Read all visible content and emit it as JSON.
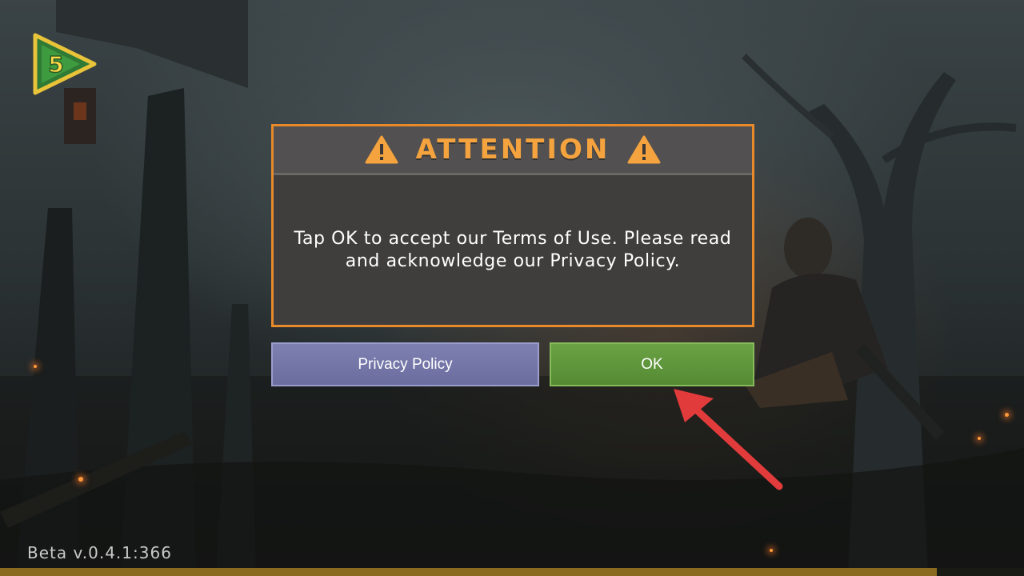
{
  "dialog": {
    "title": "ATTENTION",
    "message": "Tap OK to accept our Terms of Use. Please read and acknowledge our Privacy Policy.",
    "icon": "warning-triangle-icon",
    "accent_color": "#f4a33e"
  },
  "buttons": {
    "privacy_label": "Privacy Policy",
    "ok_label": "OK"
  },
  "logo": {
    "text": "5",
    "icon": "play-logo-icon"
  },
  "footer": {
    "version": "Beta v.0.4.1:366"
  },
  "loading": {
    "progress": 0.915
  },
  "colors": {
    "ok_button": "#5e9a3a",
    "privacy_button": "#7476a8",
    "dialog_border": "#e8892a",
    "annotation_arrow": "#e23b3b"
  }
}
